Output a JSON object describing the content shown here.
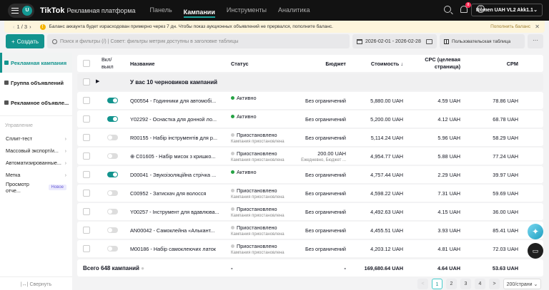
{
  "header": {
    "avatar_letter": "U",
    "brand": "TikTok",
    "platform": "Рекламная платформа",
    "nav": [
      "Панель",
      "Кампании",
      "Инструменты",
      "Аналитика"
    ],
    "notifications": "8",
    "account": "Romen UAH VL2 Akk1.1"
  },
  "banner": {
    "page": "1 / 3",
    "message": "Баланс аккаунта будет израсходован примерно через 7 дн. Чтобы показ аукционных объявлений не прервался, пополните баланс.",
    "action": "Пополнить баланс"
  },
  "toolbar": {
    "create": "Создать",
    "search_placeholder": "Поиск и фильтры (/) | Совет: фильтры метрик доступны в заголовке таблицы",
    "date_range": "2026-02-01 - 2026-02-28",
    "custom_table": "Пользовательская таблица",
    "more": "···"
  },
  "sidebar": {
    "levels": [
      "Рекламная кампания",
      "Группа объявлений",
      "Рекламное объявле..."
    ],
    "section": "Управление",
    "links": [
      "Сплит-тест",
      "Массовый экспорт/и...",
      "Автоматизированные...",
      "Метка"
    ],
    "report": "Просмотр отче...",
    "new_badge": "Новое",
    "collapse": "Свернуть"
  },
  "table": {
    "headers": {
      "toggle": "Вкл/\nвыкл",
      "name": "Название",
      "status": "Статус",
      "budget": "Бюджет",
      "cost": "Стоимость ↓",
      "cpc": "CPC (целевая страница)",
      "cpm": "CPM"
    },
    "drafts": "У вас 10 черновиков кампаний",
    "rows": [
      {
        "on": true,
        "name": "Q00554 - Годинники для автомобі...",
        "status": "Активно",
        "status_sub": "",
        "budget": "Без ограничений",
        "budget_sub": "",
        "cost": "5,880.00 UAH",
        "cpc": "4.59 UAH",
        "cpm": "78.86 UAH"
      },
      {
        "on": true,
        "name": "Y02292 - Оснастка для донной ло...",
        "status": "Активно",
        "status_sub": "",
        "budget": "Без ограничений",
        "budget_sub": "",
        "cost": "5,200.00 UAH",
        "cpc": "4.12 UAH",
        "cpm": "68.78 UAH"
      },
      {
        "on": false,
        "name": "R00155 - Набір інструментів для р...",
        "status": "Приостановлено",
        "status_sub": "Кампания приостановлена",
        "budget": "Без ограничений",
        "budget_sub": "",
        "cost": "5,114.24 UAH",
        "cpc": "5.96 UAH",
        "cpm": "58.29 UAH"
      },
      {
        "on": false,
        "name": "⊕ C01605 - Набір мисок з кришко...",
        "status": "Приостановлено",
        "status_sub": "Кампания приостановлена",
        "budget": "200.00 UAH",
        "budget_sub": "Ежедневно, Бюджет ...",
        "cost": "4,954.77 UAH",
        "cpc": "5.88 UAH",
        "cpm": "77.24 UAH"
      },
      {
        "on": true,
        "name": "D00041 - Звукоізоляційна стрічка ...",
        "status": "Активно",
        "status_sub": "",
        "budget": "Без ограничений",
        "budget_sub": "",
        "cost": "4,757.44 UAH",
        "cpc": "2.29 UAH",
        "cpm": "39.97 UAH"
      },
      {
        "on": false,
        "name": "C00952 - Затискач для волосся",
        "status": "Приостановлено",
        "status_sub": "Кампания приостановлена",
        "budget": "Без ограничений",
        "budget_sub": "",
        "cost": "4,598.22 UAH",
        "cpc": "7.31 UAH",
        "cpm": "59.69 UAH"
      },
      {
        "on": false,
        "name": "Y00257 - Інструмент для вдавлюва...",
        "status": "Приостановлено",
        "status_sub": "Кампания приостановлена",
        "budget": "Без ограничений",
        "budget_sub": "",
        "cost": "4,492.63 UAH",
        "cpc": "4.15 UAH",
        "cpm": "36.00 UAH"
      },
      {
        "on": false,
        "name": "AN00042 - Самоклейна «Алькант...",
        "status": "Приостановлено",
        "status_sub": "Кампания приостановлена",
        "budget": "Без ограничений",
        "budget_sub": "",
        "cost": "4,455.51 UAH",
        "cpc": "3.93 UAH",
        "cpm": "85.41 UAH"
      },
      {
        "on": false,
        "name": "M00186 - Набір самоклеючих латок",
        "status": "Приостановлено",
        "status_sub": "Кампания приостановлена",
        "budget": "Без ограничений",
        "budget_sub": "",
        "cost": "4,203.12 UAH",
        "cpc": "4.81 UAH",
        "cpm": "72.03 UAH"
      }
    ],
    "totals": {
      "label": "Всего 648 кампаний",
      "status": "-",
      "budget": "-",
      "cost": "169,680.64 UAH",
      "cpc": "4.64 UAH",
      "cpm": "53.63 UAH"
    }
  },
  "pagination": {
    "prev": "<",
    "pages": [
      "1",
      "2",
      "3",
      "4"
    ],
    "next": ">",
    "per_page": "200/страни ⌄"
  },
  "colors": {
    "accent": "#13948e",
    "active": "#25a244",
    "paused": "#cccccc"
  }
}
